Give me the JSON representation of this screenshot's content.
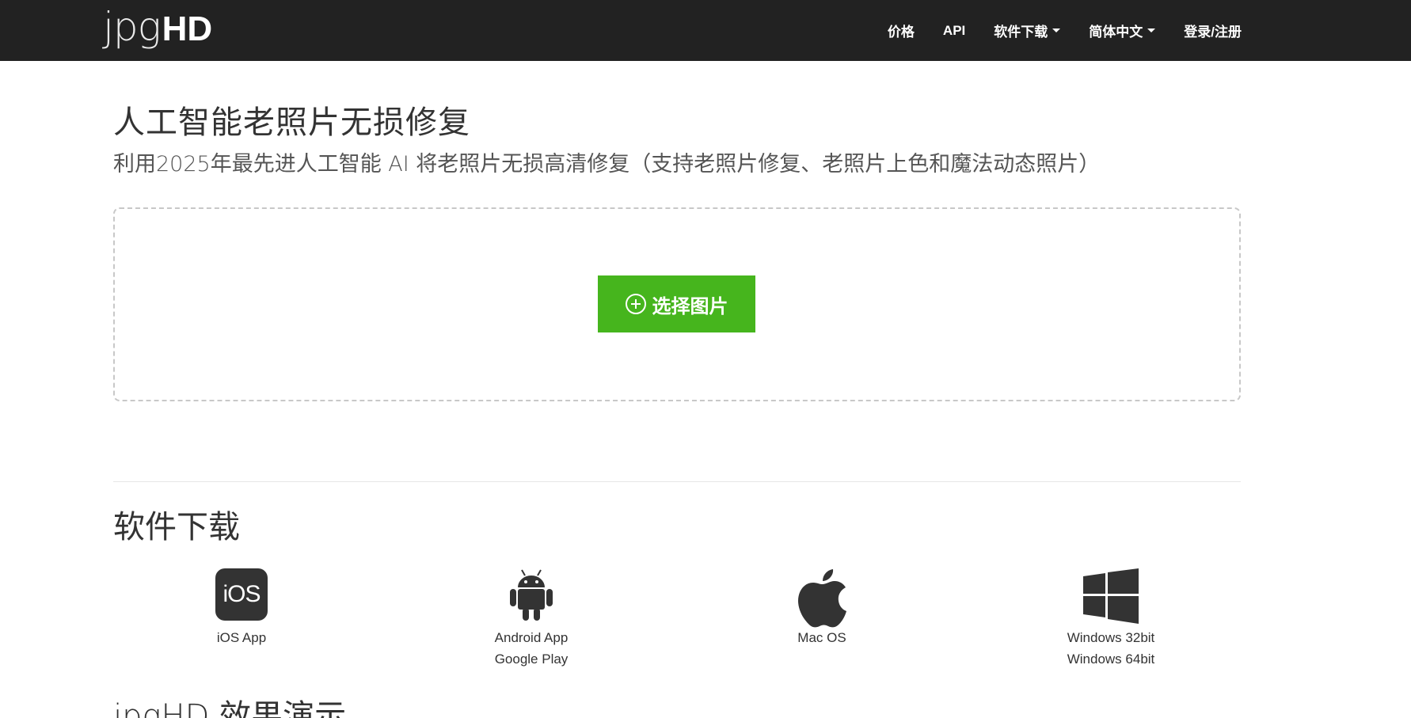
{
  "header": {
    "logo_light": "jpg",
    "logo_bold": "HD",
    "nav": {
      "price": "价格",
      "api": "API",
      "download": "软件下载",
      "language": "简体中文",
      "login": "登录/注册"
    }
  },
  "hero": {
    "title": "人工智能老照片无损修复",
    "subtitle": "利用2025年最先进人工智能 AI 将老照片无损高清修复（支持老照片修复、老照片上色和魔法动态照片）",
    "select_button": "选择图片"
  },
  "downloads": {
    "title": "软件下载",
    "items": [
      {
        "icon": "ios-icon",
        "icon_text": "iOS",
        "line1": "iOS App",
        "line2": ""
      },
      {
        "icon": "android-icon",
        "line1": "Android App",
        "line2": "Google Play"
      },
      {
        "icon": "apple-icon",
        "line1": "Mac OS",
        "line2": ""
      },
      {
        "icon": "windows-icon",
        "line1": "Windows 32bit",
        "line2": "Windows 64bit"
      }
    ]
  },
  "demo": {
    "title": "jpgHD 效果演示"
  },
  "colors": {
    "navbar": "#222222",
    "accent_green": "#46b51d"
  }
}
